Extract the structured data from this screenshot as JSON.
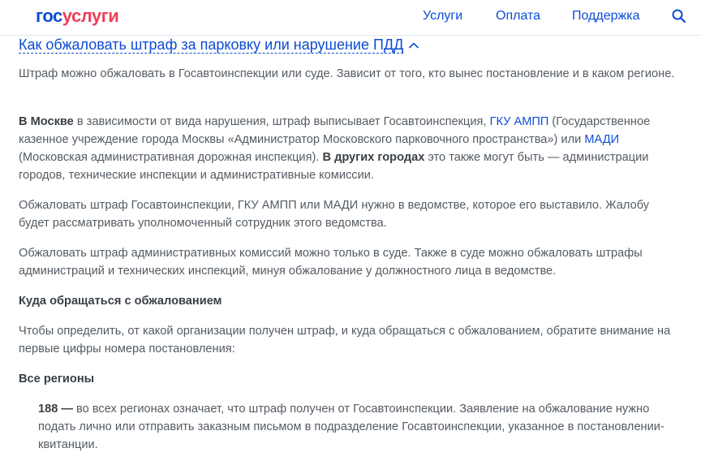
{
  "header": {
    "logo_part1": "гос",
    "logo_part2": "услуги",
    "nav": [
      "Услуги",
      "Оплата",
      "Поддержка"
    ]
  },
  "icons": {
    "search": "search-icon",
    "accordion": "chevron-up-icon"
  },
  "colors": {
    "brand_blue": "#0d4cd3",
    "brand_red": "#ee3f58",
    "text": "#535b63"
  },
  "article": {
    "title": "Как обжаловать штраф за парковку или нарушение ПДД",
    "p1": "Штраф можно обжаловать в Госавтоинспекции или суде. Зависит от того, кто вынес постановление и в каком регионе.",
    "p2": {
      "b1": "В Москве",
      "t1": " в зависимости от вида нарушения, штраф выписывает Госавтоинспекция, ",
      "link1": "ГКУ АМПП",
      "t2": " (Государственное казенное учреждение города Москвы «Администратор Московского парковочного пространства») или ",
      "link2": "МАДИ",
      "t3": " (Московская административная дорожная инспекция). ",
      "b2": "В других городах",
      "t4": " это также могут быть — администрации городов, технические инспекции и административные комиссии."
    },
    "p3": "Обжаловать штраф Госавтоинспекции, ГКУ АМПП или МАДИ нужно в ведомстве, которое его выставило. Жалобу будет рассматривать уполномоченный сотрудник этого ведомства.",
    "p4": "Обжаловать штраф административных комиссий можно только в суде. Также в суде можно обжаловать штрафы администраций и технических инспекций, минуя обжалование у должностного лица в ведомстве.",
    "h1": "Куда обращаться с обжалованием",
    "p5": "Чтобы определить, от какой организации получен штраф, и куда обращаться с обжалованием, обратите внимание на первые цифры номера постановления:",
    "h2": "Все регионы",
    "item1": {
      "code": "188 —",
      "text": " во всех регионах означает, что штраф получен от Госавтоинспекции. Заявление на обжалование нужно подать лично или отправить заказным письмом в подразделение Госавтоинспекции, указанное в постановлении-квитанции."
    }
  }
}
